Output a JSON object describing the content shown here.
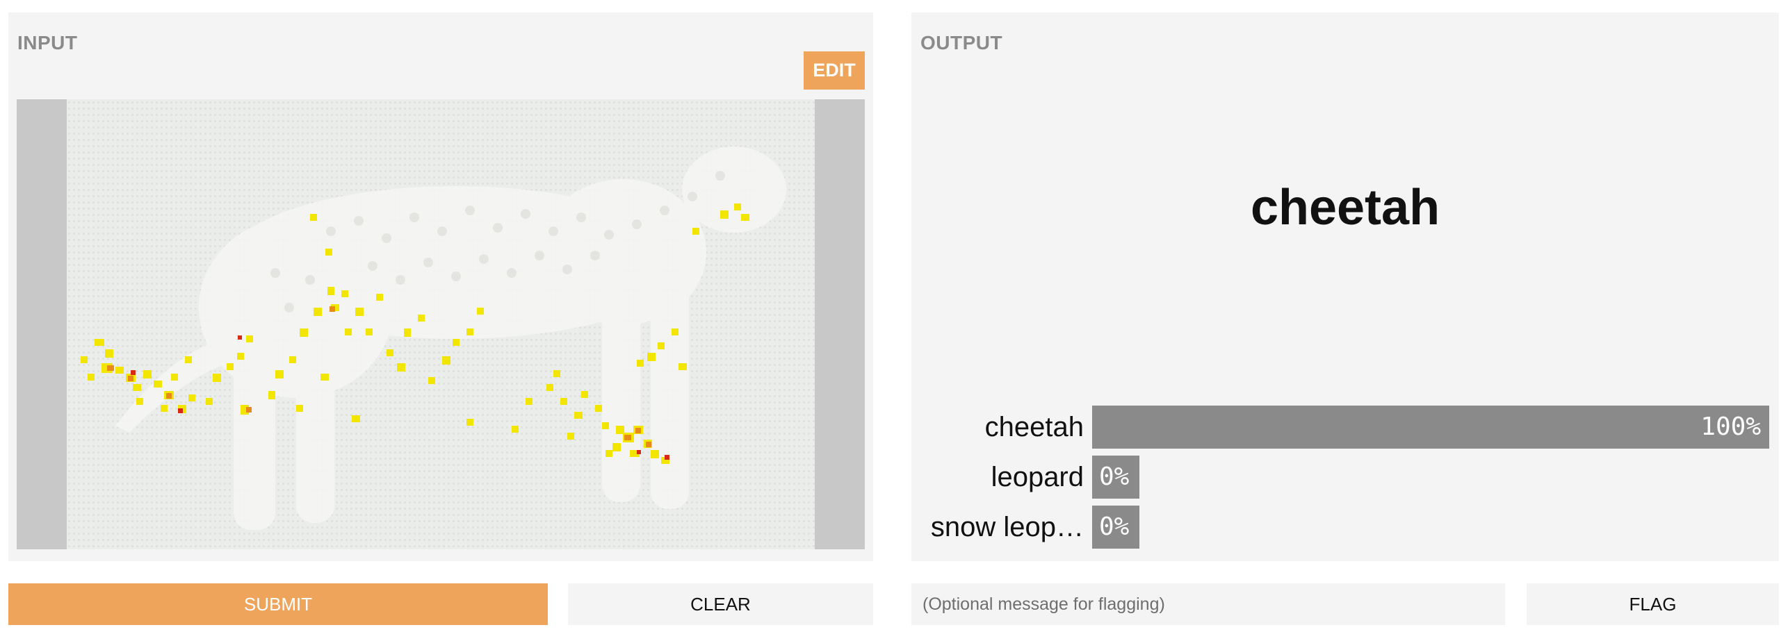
{
  "input": {
    "title": "INPUT",
    "edit_label": "EDIT"
  },
  "output": {
    "title": "OUTPUT",
    "prediction": "cheetah",
    "confidences": [
      {
        "label": "cheetah",
        "value": 1.0,
        "display": "100%"
      },
      {
        "label": "leopard",
        "value": 0.0,
        "display": "0%"
      },
      {
        "label": "snow leop…",
        "value": 0.0,
        "display": "0%"
      }
    ]
  },
  "actions": {
    "submit_label": "SUBMIT",
    "clear_label": "CLEAR",
    "flag_placeholder": "(Optional message for flagging)",
    "flag_label": "FLAG"
  },
  "colors": {
    "accent": "#eea55b",
    "panel_bg": "#f4f4f4",
    "bar_fill": "#8a8a8a",
    "heat_low": "#f2e600",
    "heat_high": "#d62a14"
  }
}
